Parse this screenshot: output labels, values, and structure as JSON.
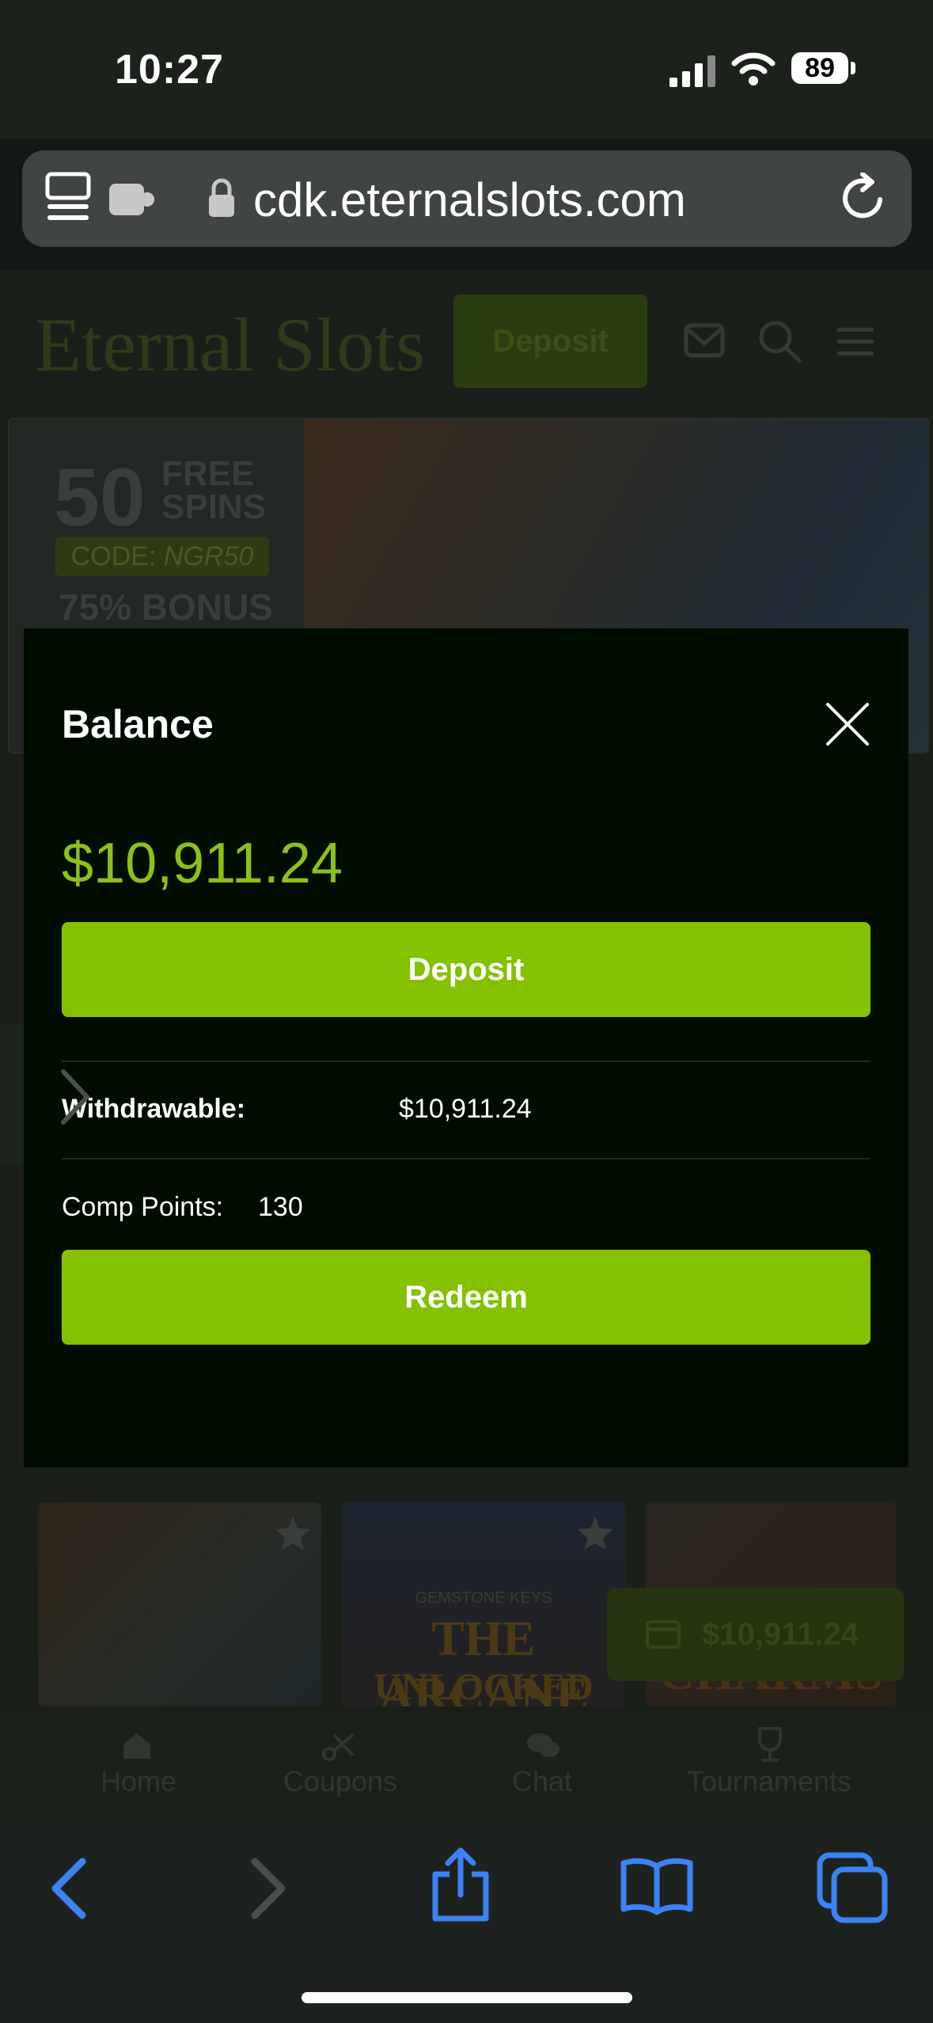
{
  "status_bar": {
    "time": "10:27",
    "battery": "89"
  },
  "browser": {
    "url": "cdk.eternalslots.com"
  },
  "site": {
    "logo": "Eternal Slots",
    "header_deposit": "Deposit",
    "banner": {
      "big_number": "50",
      "free": "FREE",
      "spins": "SPINS",
      "code_label": "CODE:",
      "code": "NGR50",
      "bonus": "75% BONUS"
    },
    "games": [
      {
        "title": ""
      },
      {
        "title_line1": "GEMSTONE KEYS",
        "title_line2": "THE ARCANE",
        "title_line3": "UNLOCKED"
      },
      {
        "title": "CHARMS"
      }
    ],
    "floating_balance": "$10,911.24",
    "bottom_nav": [
      {
        "label": "Home",
        "icon": "home-icon"
      },
      {
        "label": "Coupons",
        "icon": "coupon-icon"
      },
      {
        "label": "Chat",
        "icon": "chat-icon"
      },
      {
        "label": "Tournaments",
        "icon": "trophy-icon"
      }
    ]
  },
  "modal": {
    "title": "Balance",
    "balance": "$10,911.24",
    "deposit_label": "Deposit",
    "withdrawable_label": "Withdrawable:",
    "withdrawable_value": "$10,911.24",
    "comp_points_label": "Comp Points:",
    "comp_points_value": "130",
    "redeem_label": "Redeem"
  },
  "colors": {
    "accent": "#84c101",
    "balance_text": "#8ac11a",
    "modal_bg": "#000c00",
    "toolbar_icons": "#3b82f6"
  }
}
